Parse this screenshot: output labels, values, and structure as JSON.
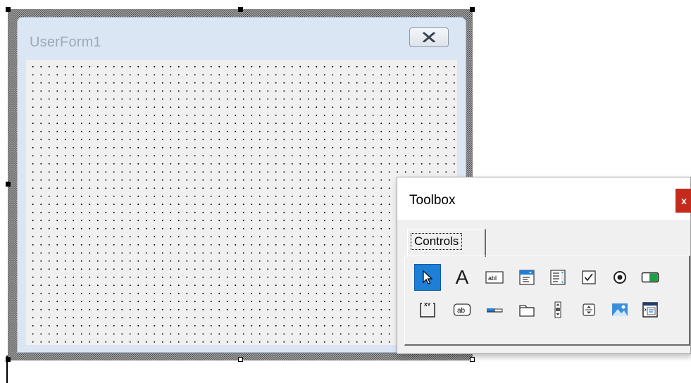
{
  "form": {
    "title": "UserForm1",
    "close_icon": "close-x-icon"
  },
  "toolbox": {
    "title": "Toolbox",
    "close_label": "x",
    "tabs": [
      {
        "label": "Controls"
      }
    ],
    "controls_row1": [
      {
        "name": "select-objects",
        "icon": "pointer-icon",
        "selected": true
      },
      {
        "name": "label",
        "icon": "label-A-icon",
        "glyph": "A"
      },
      {
        "name": "textbox",
        "icon": "textbox-icon",
        "glyph": "abl"
      },
      {
        "name": "combobox",
        "icon": "combobox-icon"
      },
      {
        "name": "listbox",
        "icon": "listbox-icon"
      },
      {
        "name": "checkbox",
        "icon": "checkbox-icon"
      },
      {
        "name": "optionbutton",
        "icon": "radio-icon"
      },
      {
        "name": "togglebutton",
        "icon": "toggle-icon"
      }
    ],
    "controls_row2": [
      {
        "name": "frame",
        "icon": "frame-icon",
        "glyph": "XY"
      },
      {
        "name": "commandbutton",
        "icon": "command-button-icon",
        "glyph": "ab"
      },
      {
        "name": "tabstrip",
        "icon": "tabstrip-icon"
      },
      {
        "name": "multipage",
        "icon": "multipage-icon"
      },
      {
        "name": "scrollbar",
        "icon": "scrollbar-icon"
      },
      {
        "name": "spinbutton",
        "icon": "spinbutton-icon"
      },
      {
        "name": "image",
        "icon": "image-icon"
      },
      {
        "name": "refedit",
        "icon": "refedit-icon"
      }
    ],
    "colors": {
      "selected": "#1e7fd6",
      "close": "#c42b1c",
      "accent_blue": "#1e7fd6",
      "toggle_green": "#1e9e46"
    }
  }
}
